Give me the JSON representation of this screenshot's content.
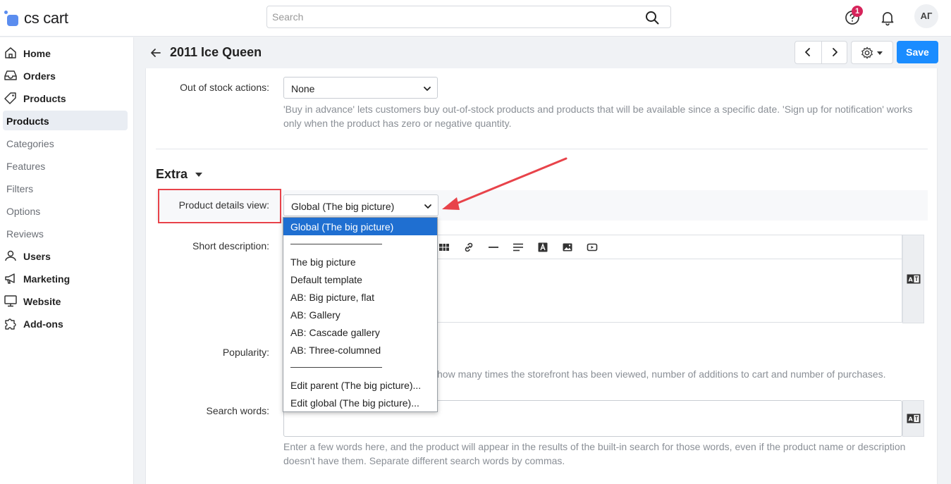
{
  "brand": {
    "logo_text": "cs cart"
  },
  "header": {
    "search_placeholder": "Search",
    "notification_badge": "1",
    "avatar_initials": "АГ"
  },
  "sidebar": {
    "items": [
      {
        "label": "Home",
        "icon": "home-icon"
      },
      {
        "label": "Orders",
        "icon": "inbox-icon"
      },
      {
        "label": "Products",
        "icon": "tag-icon"
      }
    ],
    "sub_items": [
      {
        "label": "Products",
        "active": true
      },
      {
        "label": "Categories"
      },
      {
        "label": "Features"
      },
      {
        "label": "Filters"
      },
      {
        "label": "Options"
      },
      {
        "label": "Reviews"
      }
    ],
    "items_after": [
      {
        "label": "Users",
        "icon": "user-icon"
      },
      {
        "label": "Marketing",
        "icon": "megaphone-icon"
      },
      {
        "label": "Website",
        "icon": "monitor-icon"
      },
      {
        "label": "Add-ons",
        "icon": "puzzle-icon"
      }
    ]
  },
  "page": {
    "title": "2011 Ice Queen",
    "save_label": "Save"
  },
  "form": {
    "out_of_stock": {
      "label": "Out of stock actions:",
      "value": "None",
      "help": "'Buy in advance' lets customers buy out-of-stock products and products that will be available since a specific date. 'Sign up for notification' works only when the product has zero or negative quantity."
    },
    "section_title": "Extra",
    "details_view": {
      "label": "Product details view:",
      "value": "Global (The big picture)"
    },
    "short_description": {
      "label": "Short description:"
    },
    "popularity": {
      "label": "Popularity:",
      "help": "how many times the storefront has been viewed, number of additions to cart and number of purchases."
    },
    "search_words": {
      "label": "Search words:",
      "help": "Enter a few words here, and the product will appear in the results of the built-in search for those words, even if the product name or description doesn't have them. Separate different search words by commas."
    }
  },
  "dropdown": {
    "options": [
      "Global (The big picture)",
      "The big picture",
      "Default template",
      "AB: Big picture, flat",
      "AB: Gallery",
      "AB: Cascade gallery",
      "AB: Three-columned",
      "Edit parent (The big picture)...",
      "Edit global (The big picture)..."
    ]
  },
  "colors": {
    "accent": "#1a8cff",
    "selected_option": "#1f6fd1",
    "annotation": "#e8434a",
    "badge": "#d6245b"
  }
}
